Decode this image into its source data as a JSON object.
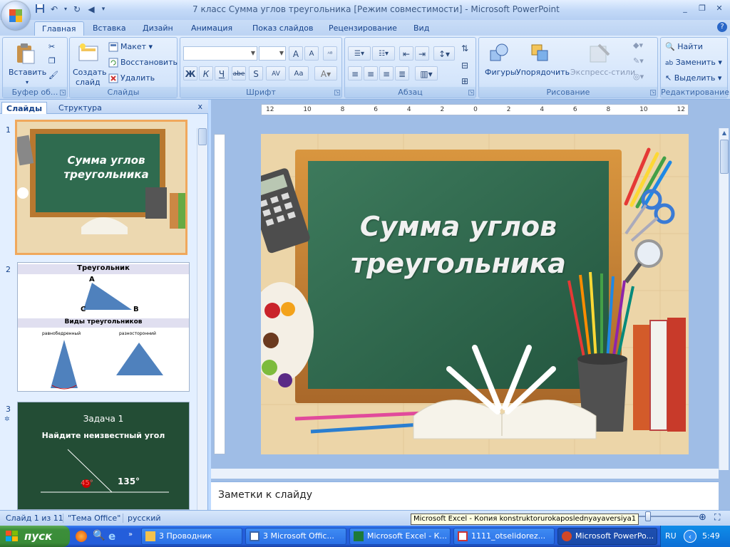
{
  "window": {
    "title": "7 класс Сумма углов треугольника [Режим совместимости] - Microsoft PowerPoint"
  },
  "tabs": [
    "Главная",
    "Вставка",
    "Дизайн",
    "Анимация",
    "Показ слайдов",
    "Рецензирование",
    "Вид"
  ],
  "ribbon": {
    "clipboard": {
      "paste": "Вставить",
      "label": "Буфер об..."
    },
    "slides": {
      "create": "Создать",
      "create2": "слайд",
      "layout": "Макет",
      "reset": "Восстановить",
      "delete": "Удалить",
      "label": "Слайды"
    },
    "font": {
      "label": "Шрифт",
      "bold": "Ж",
      "italic": "К",
      "underline": "Ч",
      "strike": "abe",
      "shadow": "S"
    },
    "paragraph": {
      "label": "Абзац"
    },
    "drawing": {
      "shapes": "Фигуры",
      "arrange": "Упорядочить",
      "styles": "Экспресс-стили",
      "label": "Рисование"
    },
    "editing": {
      "find": "Найти",
      "replace": "Заменить",
      "select": "Выделить",
      "label": "Редактирование"
    }
  },
  "panel": {
    "tab_slides": "Слайды",
    "tab_outline": "Структура",
    "close": "x"
  },
  "thumbs": {
    "t1": {
      "num": "1",
      "title": "Сумма углов треугольника"
    },
    "t2": {
      "num": "2",
      "h1": "Треугольник",
      "a": "A",
      "b": "B",
      "c": "C",
      "h2": "Виды треугольников",
      "iso": "равнобедренный",
      "scal": "разносторонний"
    },
    "t3": {
      "num": "3",
      "task": "Задача 1",
      "q": "Найдите неизвестный угол",
      "angle1": "135°",
      "angle2": "45°"
    }
  },
  "ruler": {
    "h": [
      "12",
      "10",
      "8",
      "6",
      "4",
      "2",
      "0",
      "2",
      "4",
      "6",
      "8",
      "10",
      "12"
    ]
  },
  "slide": {
    "title_line1": "Сумма углов",
    "title_line2": "треугольника"
  },
  "notes": {
    "placeholder": "Заметки к слайду"
  },
  "status": {
    "slide_of": "Слайд 1 из 11",
    "theme": "\"Тема Office\"",
    "lang": "русский",
    "tooltip": "Microsoft Excel - Копия konstruktorurokaposlednyayaversiya1"
  },
  "taskbar": {
    "start": "пуск",
    "items": [
      "3 Проводник",
      "3 Microsoft Offic...",
      "Microsoft Excel - К...",
      "1111_otselidorez...",
      "Microsoft PowerPo..."
    ],
    "lang": "RU",
    "time": "5:49"
  },
  "colors": {
    "chalkboard": "#2f6b4f",
    "frame": "#c98a3c",
    "accent": "#245edb"
  }
}
